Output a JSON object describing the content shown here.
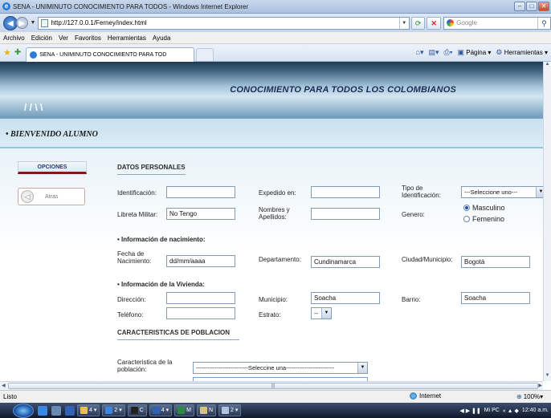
{
  "window": {
    "title": "SENA - UNIMINUTO CONOCIMIENTO PARA TODOS - Windows Internet Explorer",
    "controls": {
      "minimize": "–",
      "maximize": "□",
      "close": "✕"
    }
  },
  "address_bar": {
    "url": "http://127.0.0.1/Ferney/index.html",
    "search_placeholder": "Google"
  },
  "menu": [
    "Archivo",
    "Edición",
    "Ver",
    "Favoritos",
    "Herramientas",
    "Ayuda"
  ],
  "tab": {
    "label": "SENA - UNIMINUTO CONOCIMIENTO PARA TOD"
  },
  "command_bar": {
    "page_label": "Página",
    "tools_label": "Herramientas"
  },
  "page": {
    "banner_title": "CONOCIMIENTO PARA TODOS LOS COLOMBIANOS",
    "welcome": "• BIENVENIDO ALUMNO",
    "sidebar": {
      "opciones": "OPCIONES",
      "atras": "Atras"
    },
    "form": {
      "title": "DATOS PERSONALES",
      "identificacion_label": "Identificación:",
      "expedido_label": "Expedido en:",
      "tipo_ident_label_1": "Tipo de",
      "tipo_ident_label_2": "Identificación:",
      "tipo_ident_value": "---Seleccione uno---",
      "libreta_label": "Libreta Militar:",
      "libreta_value": "No Tengo",
      "nombres_label_1": "Nombres y",
      "nombres_label_2": "Apellidos:",
      "genero_label": "Genero:",
      "genero_options": [
        "Masculino",
        "Femenino"
      ],
      "genero_selected": "Masculino",
      "nacimiento_header": "Información de nacimiento:",
      "fecha_label_1": "Fecha de",
      "fecha_label_2": "Nacimiento:",
      "fecha_value": "dd/mm/aaaa",
      "departamento_label": "Departamento:",
      "departamento_value": "Cundinamarca",
      "ciudad_label": "Ciudad/Municipio:",
      "ciudad_value": "Bogotá",
      "vivienda_header": "Información de la Vivienda:",
      "direccion_label": "Dirección:",
      "municipio_label": "Municipio:",
      "municipio_value": "Soacha",
      "barrio_label": "Barrio:",
      "barrio_value": "Soacha",
      "telefono_label": "Teléfono:",
      "estrato_label": "Estrato:",
      "estrato_value": "--",
      "poblacion_title": "CARACTERISTICAS DE POBLACION",
      "caracteristica_label_1": "Caracteristica de la",
      "caracteristica_label_2": "población:",
      "caracteristica_value": "--------------------------Seleccine una------------------------"
    }
  },
  "status_bar": {
    "status": "Listo",
    "zone": "Internet",
    "zoom": "100%"
  },
  "taskbar": {
    "buttons": [
      "4 ▾",
      "2 ▾",
      "C",
      "4 ▾",
      "M",
      "N",
      "2 ▾"
    ],
    "tray_label": "Mi PC",
    "clock": "12:40 a.m."
  }
}
